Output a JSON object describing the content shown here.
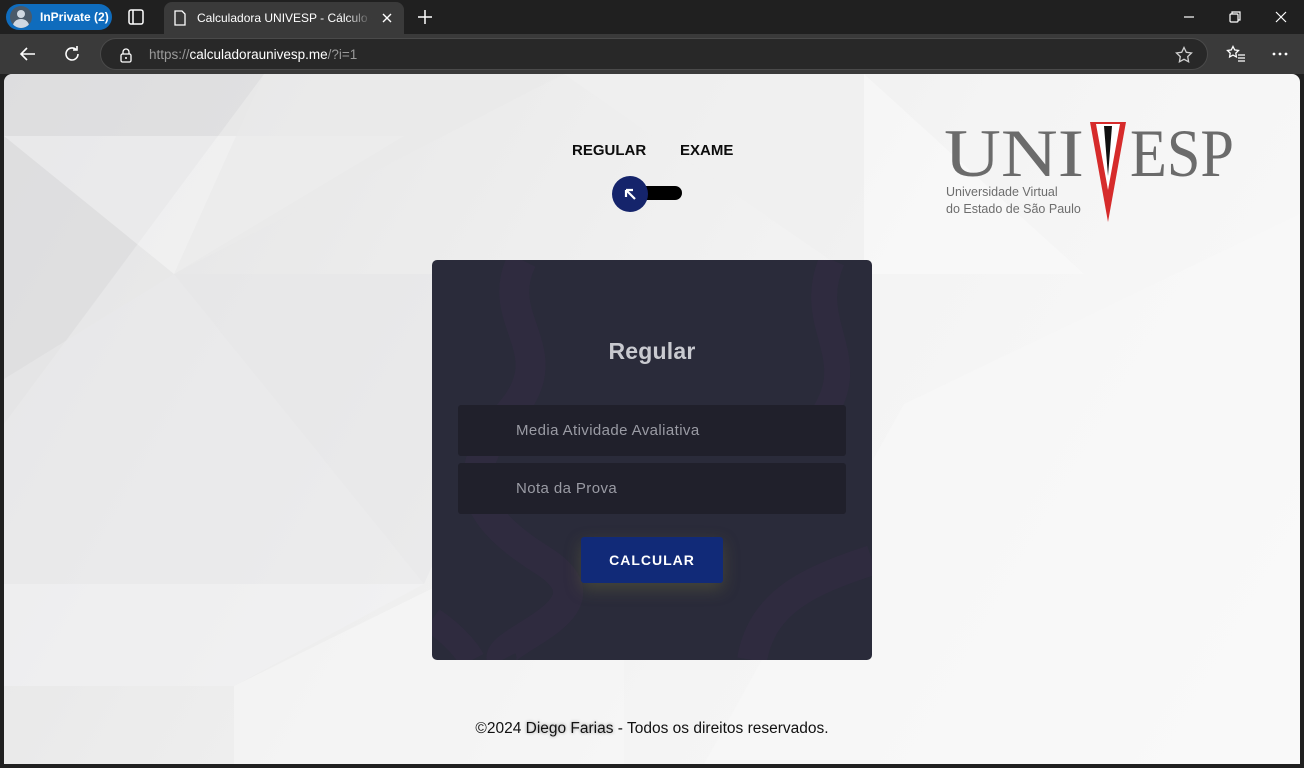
{
  "browser": {
    "profile_label": "InPrivate (2)",
    "tab_title": "Calculadora UNIVESP - Cálculo de Média",
    "url_prefix": "https://",
    "url_host": "calculadoraunivesp.me",
    "url_path": "/?i=1"
  },
  "page": {
    "mode_regular": "REGULAR",
    "mode_exame": "EXAME",
    "logo": {
      "wordmark": "UNIVESP",
      "line1": "Universidade Virtual",
      "line2": "do Estado de São Paulo",
      "accent_color": "#d62b2b"
    },
    "card": {
      "title": "Regular",
      "field1_placeholder": "Media Atividade Avaliativa",
      "field2_placeholder": "Nota da Prova",
      "button_label": "CALCULAR"
    },
    "footer": {
      "copyright": "©2024 ",
      "author": "Diego Farias",
      "rights": " - Todos os direitos reservados."
    }
  },
  "colors": {
    "knob": "#15246b",
    "button": "#112a78",
    "card": "#2a2b3a"
  }
}
